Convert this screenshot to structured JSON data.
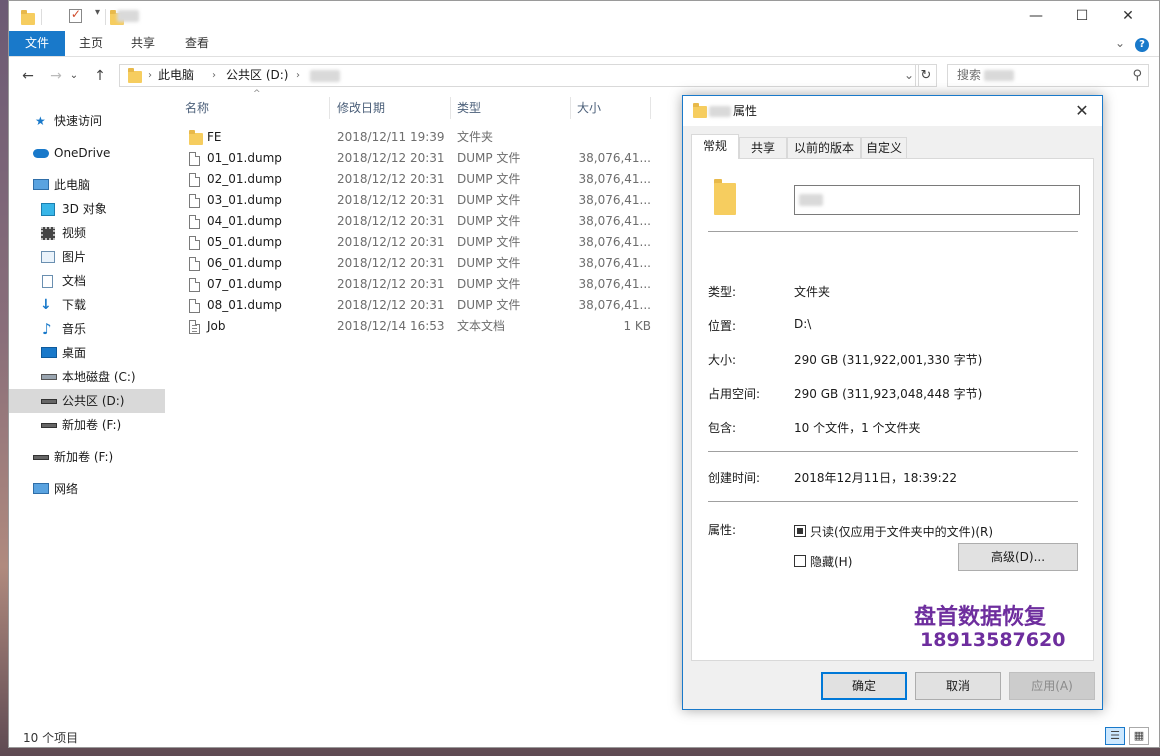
{
  "window": {
    "title_hidden": "",
    "controls": {
      "minimize": "—",
      "maximize": "☐",
      "close": "✕"
    }
  },
  "ribbon": {
    "tabs": [
      "文件",
      "主页",
      "共享",
      "查看"
    ],
    "collapse": "⌄",
    "help": "?"
  },
  "address": {
    "back": "←",
    "forward": "→",
    "recent": "⌄",
    "up": "↑",
    "segments": [
      "此电脑",
      "公共区 (D:)"
    ],
    "dropdown": "⌄",
    "refresh": "↻"
  },
  "search": {
    "placeholder": "搜索",
    "icon": "⚲"
  },
  "nav": {
    "items": [
      {
        "label": "快速访问",
        "icon": "star-icon"
      },
      {
        "label": "OneDrive",
        "icon": "cloud-icon"
      },
      {
        "label": "此电脑",
        "icon": "computer-icon"
      },
      {
        "label": "3D 对象",
        "icon": "cube-icon"
      },
      {
        "label": "视频",
        "icon": "film-icon"
      },
      {
        "label": "图片",
        "icon": "picture-icon"
      },
      {
        "label": "文档",
        "icon": "document-icon"
      },
      {
        "label": "下载",
        "icon": "download-icon"
      },
      {
        "label": "音乐",
        "icon": "music-icon"
      },
      {
        "label": "桌面",
        "icon": "desktop-icon"
      },
      {
        "label": "本地磁盘 (C:)",
        "icon": "drive-icon"
      },
      {
        "label": "公共区 (D:)",
        "icon": "drive-icon"
      },
      {
        "label": "新加卷 (F:)",
        "icon": "drive-icon"
      },
      {
        "label": "新加卷 (F:)",
        "icon": "drive-icon"
      },
      {
        "label": "网络",
        "icon": "network-icon"
      }
    ]
  },
  "columns": {
    "name": "名称",
    "modified": "修改日期",
    "type": "类型",
    "size": "大小",
    "sort_arrow": "^"
  },
  "files": [
    {
      "name": "FE",
      "modified": "2018/12/11 19:39",
      "type": "文件夹",
      "size": "",
      "kind": "folder"
    },
    {
      "name": "01_01.dump",
      "modified": "2018/12/12 20:31",
      "type": "DUMP 文件",
      "size": "38,076,41...",
      "kind": "file"
    },
    {
      "name": "02_01.dump",
      "modified": "2018/12/12 20:31",
      "type": "DUMP 文件",
      "size": "38,076,41...",
      "kind": "file"
    },
    {
      "name": "03_01.dump",
      "modified": "2018/12/12 20:31",
      "type": "DUMP 文件",
      "size": "38,076,41...",
      "kind": "file"
    },
    {
      "name": "04_01.dump",
      "modified": "2018/12/12 20:31",
      "type": "DUMP 文件",
      "size": "38,076,41...",
      "kind": "file"
    },
    {
      "name": "05_01.dump",
      "modified": "2018/12/12 20:31",
      "type": "DUMP 文件",
      "size": "38,076,41...",
      "kind": "file"
    },
    {
      "name": "06_01.dump",
      "modified": "2018/12/12 20:31",
      "type": "DUMP 文件",
      "size": "38,076,41...",
      "kind": "file"
    },
    {
      "name": "07_01.dump",
      "modified": "2018/12/12 20:31",
      "type": "DUMP 文件",
      "size": "38,076,41...",
      "kind": "file"
    },
    {
      "name": "08_01.dump",
      "modified": "2018/12/12 20:31",
      "type": "DUMP 文件",
      "size": "38,076,41...",
      "kind": "file"
    },
    {
      "name": "Job",
      "modified": "2018/12/14 16:53",
      "type": "文本文档",
      "size": "1 KB",
      "kind": "text"
    }
  ],
  "status": {
    "count": "10 个项目"
  },
  "dialog": {
    "title": "属性",
    "close": "✕",
    "tabs": [
      "常规",
      "共享",
      "以前的版本",
      "自定义"
    ],
    "fields": {
      "type_label": "类型:",
      "type_value": "文件夹",
      "location_label": "位置:",
      "location_value": "D:\\",
      "size_label": "大小:",
      "size_value": "290 GB (311,922,001,330 字节)",
      "disk_label": "占用空间:",
      "disk_value": "290 GB (311,923,048,448 字节)",
      "contains_label": "包含:",
      "contains_value": "10 个文件，1 个文件夹",
      "created_label": "创建时间:",
      "created_value": "2018年12月11日，18:39:22",
      "attr_label": "属性:",
      "readonly_label": "只读(仅应用于文件夹中的文件)(R)",
      "hidden_label": "隐藏(H)",
      "advanced_label": "高级(D)..."
    },
    "buttons": {
      "ok": "确定",
      "cancel": "取消",
      "apply": "应用(A)"
    }
  },
  "watermark": {
    "name": "盘首数据恢复",
    "phone": "18913587620"
  },
  "colors": {
    "accent": "#1979ca",
    "folder": "#f6cd5f",
    "selected": "#d9d9d9",
    "watermark": "#6e2e9e"
  }
}
